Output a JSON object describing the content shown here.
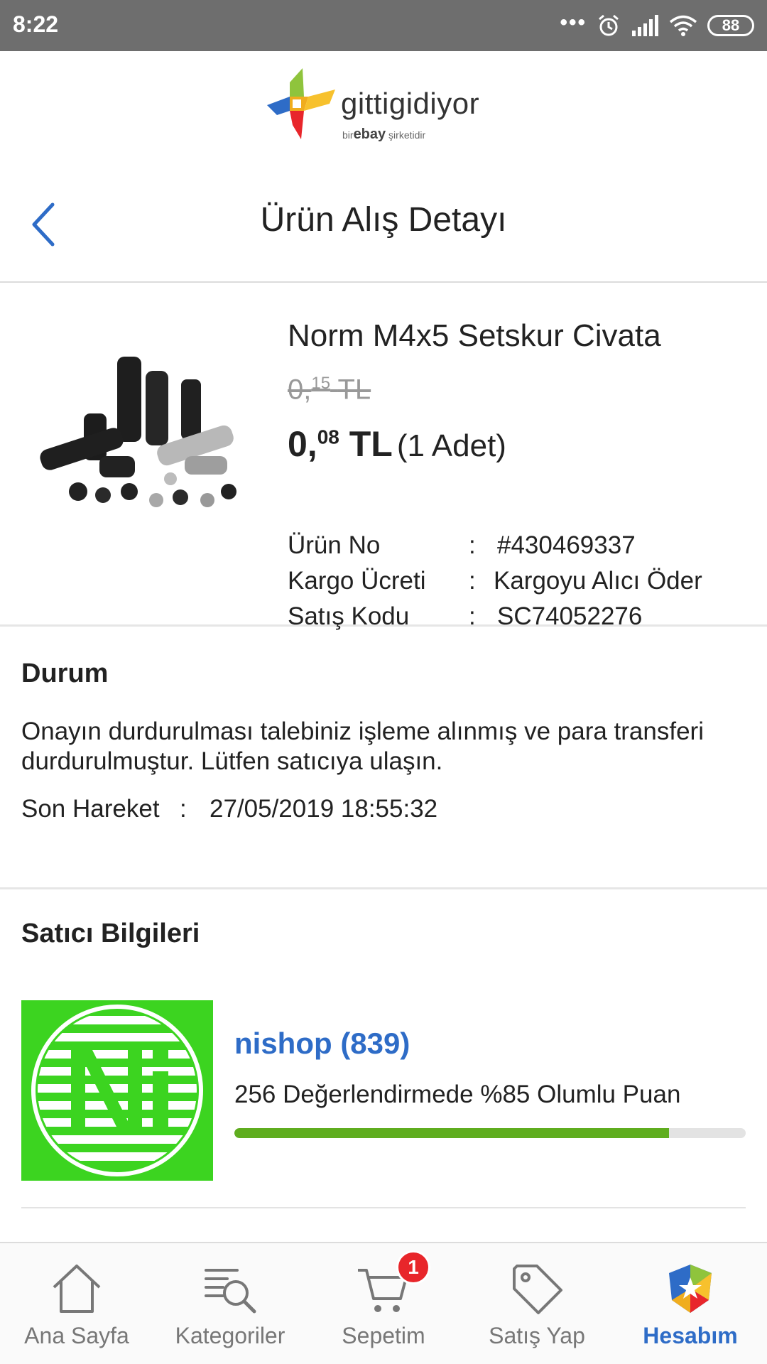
{
  "status_bar": {
    "time": "8:22",
    "battery": "88"
  },
  "logo": {
    "brand": "gittigidiyor",
    "tagline_bir": "bir",
    "tagline_ebay": "ebay",
    "tagline_rest": "şirketidir"
  },
  "header": {
    "title": "Ürün Alış Detayı"
  },
  "product": {
    "name": "Norm M4x5 Setskur Civata",
    "old_price_int": "0,",
    "old_price_dec": "15",
    "old_price_cur": "TL",
    "price_int": "0,",
    "price_dec": "08",
    "price_cur": "TL",
    "quantity": "(1 Adet)",
    "info": [
      {
        "label": "Ürün No",
        "value": "#430469337"
      },
      {
        "label": "Kargo Ücreti",
        "value": "Kargoyu Alıcı Öder"
      },
      {
        "label": "Satış Kodu",
        "value": "SC74052276"
      }
    ]
  },
  "status": {
    "title": "Durum",
    "message": "Onayın durdurulması talebiniz işleme alınmış ve para transferi durdurulmuştur. Lütfen satıcıya ulaşın.",
    "last_action_label": "Son Hareket",
    "last_action_value": "27/05/2019 18:55:32"
  },
  "seller": {
    "title": "Satıcı Bilgileri",
    "name": "nishop (839)",
    "rating_text": "256 Değerlendirmede %85 Olumlu Puan",
    "rating_percent": 85
  },
  "nav": {
    "items": [
      {
        "label": "Ana Sayfa",
        "icon": "home-icon"
      },
      {
        "label": "Kategoriler",
        "icon": "categories-search-icon"
      },
      {
        "label": "Sepetim",
        "icon": "cart-icon",
        "badge": "1"
      },
      {
        "label": "Satış Yap",
        "icon": "tag-icon"
      },
      {
        "label": "Hesabım",
        "icon": "account-shield-icon",
        "active": true
      }
    ]
  },
  "colors": {
    "accent": "#2e6cc7",
    "rating_fill": "#5fad1f",
    "badge": "#e8262b",
    "seller_logo_bg": "#3cd420"
  }
}
